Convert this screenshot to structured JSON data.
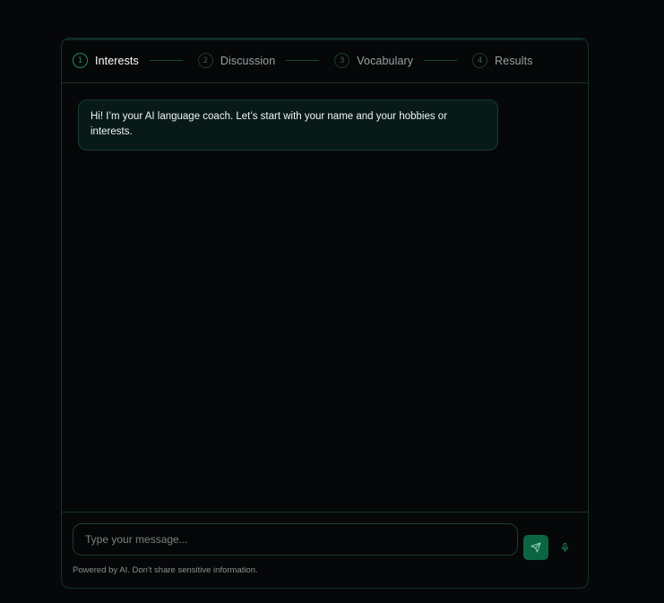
{
  "steps": [
    {
      "number": "1",
      "label": "Interests",
      "active": true
    },
    {
      "number": "2",
      "label": "Discussion",
      "active": false
    },
    {
      "number": "3",
      "label": "Vocabulary",
      "active": false
    },
    {
      "number": "4",
      "label": "Results",
      "active": false
    }
  ],
  "messages": [
    {
      "role": "assistant",
      "text": "Hi! I’m your AI language coach. Let’s start with your name and your hobbies or interests."
    }
  ],
  "composer": {
    "value": "",
    "placeholder": "Type your message...",
    "send_icon": "send-icon",
    "mic_icon": "microphone-icon",
    "footnote": "Powered by AI. Don't share sensitive information."
  },
  "colors": {
    "accent": "#1f8f5f",
    "send_button": "#0a6642",
    "border": "#123527",
    "bubble_bg": "#071a17",
    "page_bg": "#06070a"
  }
}
